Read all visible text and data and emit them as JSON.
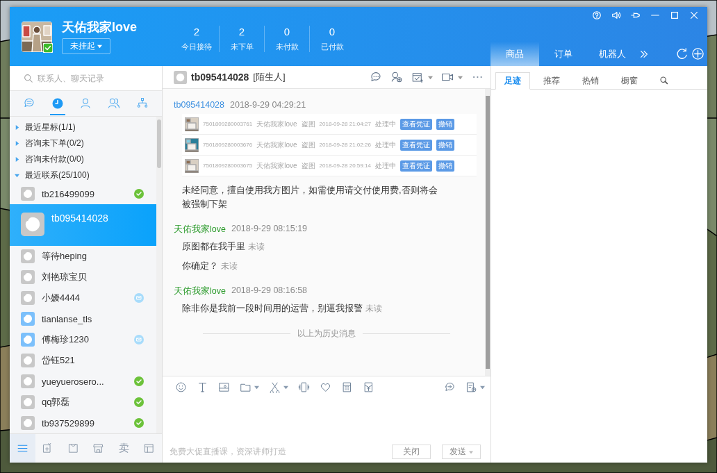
{
  "user": {
    "name": "天佑我家love",
    "status": "未挂起",
    "online": true
  },
  "stats": [
    {
      "value": "2",
      "label": "今日接待"
    },
    {
      "value": "2",
      "label": "未下单"
    },
    {
      "value": "0",
      "label": "未付款"
    },
    {
      "value": "0",
      "label": "已付款"
    }
  ],
  "right_tabs": [
    {
      "label": "商品",
      "selected": true
    },
    {
      "label": "订单",
      "selected": false
    },
    {
      "label": "机器人",
      "selected": false
    }
  ],
  "right_subtabs": [
    {
      "label": "足迹",
      "selected": true
    },
    {
      "label": "推荐",
      "selected": false
    },
    {
      "label": "热销",
      "selected": false
    },
    {
      "label": "橱窗",
      "selected": false
    }
  ],
  "sidebar": {
    "search": {
      "placeholder": "联系人、聊天记录"
    },
    "nav": [
      {
        "selected": false
      },
      {
        "selected": true
      },
      {
        "selected": false
      },
      {
        "selected": false
      },
      {
        "selected": false
      }
    ],
    "groups": [
      {
        "label": "最近星标(1/1)",
        "expanded": false
      },
      {
        "label": "咨询未下单(0/2)",
        "expanded": false
      },
      {
        "label": "咨询未付款(0/0)",
        "expanded": false
      },
      {
        "label": "最近联系(25/100)",
        "expanded": true
      }
    ],
    "contacts": [
      {
        "name": "tb216499099",
        "color": "#c8c8c8",
        "verified": true,
        "new_message": false,
        "selected": false
      },
      {
        "name": "tb095414028",
        "color": "#c8c8c8",
        "verified": false,
        "new_message": false,
        "selected": true
      },
      {
        "name": "等待heping",
        "color": "#c8c8c8",
        "verified": false,
        "new_message": false,
        "selected": false
      },
      {
        "name": "刘艳琼宝贝",
        "color": "#c8c8c8",
        "verified": false,
        "new_message": false,
        "selected": false
      },
      {
        "name": "小嫒4444",
        "color": "#c8c8c8",
        "verified": false,
        "new_message": true,
        "selected": false
      },
      {
        "name": "tianlanse_tls",
        "color": "#7cc0fb",
        "verified": false,
        "new_message": false,
        "selected": false
      },
      {
        "name": "傅梅珍1230",
        "color": "#7cc0fb",
        "verified": false,
        "new_message": true,
        "selected": false
      },
      {
        "name": "岱钰521",
        "color": "#c8c8c8",
        "verified": false,
        "new_message": false,
        "selected": false
      },
      {
        "name": "yueyuerosero...",
        "color": "#c8c8c8",
        "verified": true,
        "new_message": false,
        "selected": false
      },
      {
        "name": "qq郭磊",
        "color": "#c8c8c8",
        "verified": true,
        "new_message": false,
        "selected": false
      },
      {
        "name": "tb937529899",
        "color": "#c8c8c8",
        "verified": true,
        "new_message": false,
        "selected": false
      }
    ],
    "footer": [
      {
        "selected": true
      },
      {
        "selected": false
      },
      {
        "selected": false
      },
      {
        "selected": false
      },
      {
        "selected": false,
        "label": "卖"
      },
      {
        "selected": false
      }
    ]
  },
  "chat": {
    "name": "tb095414028",
    "tag": "[陌生人]",
    "messages": [
      {
        "sender": "tb095414028",
        "is_self": false,
        "time": "2018-9-29 04:29:21",
        "items": [
          {
            "kind": "screenshot",
            "rows": [
              {
                "id": "7501809280003761",
                "shop": "天佑我家love",
                "type": "盗图",
                "time": "2018-09-28 21:04:27",
                "status": "处理中",
                "buttons": [
                  "查看凭证",
                  "撤销"
                ]
              },
              {
                "id": "7501809280003676",
                "shop": "天佑我家love",
                "type": "盗图",
                "time": "2018-09-28 21:02:26",
                "status": "处理中",
                "buttons": [
                  "查看凭证",
                  "撤销"
                ]
              },
              {
                "id": "7501809280003675",
                "shop": "天佑我家love",
                "type": "盗图",
                "time": "2018-09-28 20:59:14",
                "status": "处理中",
                "buttons": [
                  "查看凭证",
                  "撤销"
                ]
              }
            ]
          },
          {
            "kind": "text",
            "text": "未经同意，擅自使用我方图片，如需使用请交付使用费,否则将会被强制下架"
          }
        ]
      },
      {
        "sender": "天佑我家love",
        "is_self": true,
        "time": "2018-9-29 08:15:19",
        "items": [
          {
            "kind": "text",
            "text": "原图都在我手里",
            "read_status": "未读"
          },
          {
            "kind": "text",
            "text": "你确定？",
            "read_status": "未读"
          }
        ]
      },
      {
        "sender": "天佑我家love",
        "is_self": true,
        "time": "2018-9-29 08:16:58",
        "items": [
          {
            "kind": "text",
            "text": "除非你是我前一段时间用的运营，别逼我报警",
            "read_status": "未读"
          }
        ]
      }
    ],
    "history_divider": "以上为历史消息",
    "promo": "免费大促直播课，资深讲师打造",
    "buttons": [
      {
        "label": "关闭",
        "dropdown": false
      },
      {
        "label": "发送",
        "dropdown": true
      }
    ]
  }
}
